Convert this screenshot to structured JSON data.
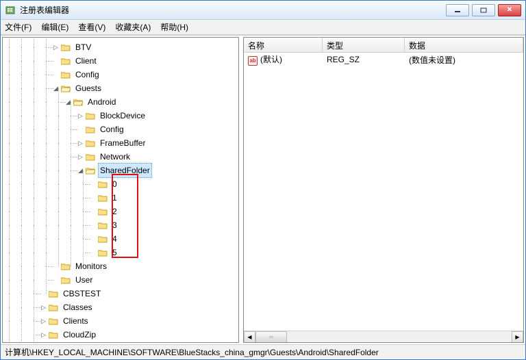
{
  "window": {
    "title": "注册表编辑器"
  },
  "menu": {
    "file": "文件(F)",
    "edit": "编辑(E)",
    "view": "查看(V)",
    "favorites": "收藏夹(A)",
    "help": "帮助(H)"
  },
  "tree": {
    "items": [
      {
        "label": "BTV",
        "depth": 4,
        "expander": "▷"
      },
      {
        "label": "Client",
        "depth": 4,
        "expander": ""
      },
      {
        "label": "Config",
        "depth": 4,
        "expander": ""
      },
      {
        "label": "Guests",
        "depth": 4,
        "expander": "◢",
        "open": true
      },
      {
        "label": "Android",
        "depth": 5,
        "expander": "◢",
        "open": true
      },
      {
        "label": "BlockDevice",
        "depth": 6,
        "expander": "▷"
      },
      {
        "label": "Config",
        "depth": 6,
        "expander": ""
      },
      {
        "label": "FrameBuffer",
        "depth": 6,
        "expander": "▷"
      },
      {
        "label": "Network",
        "depth": 6,
        "expander": "▷"
      },
      {
        "label": "SharedFolder",
        "depth": 6,
        "expander": "◢",
        "open": true,
        "selected": true
      },
      {
        "label": "0",
        "depth": 7,
        "expander": ""
      },
      {
        "label": "1",
        "depth": 7,
        "expander": ""
      },
      {
        "label": "2",
        "depth": 7,
        "expander": ""
      },
      {
        "label": "3",
        "depth": 7,
        "expander": ""
      },
      {
        "label": "4",
        "depth": 7,
        "expander": ""
      },
      {
        "label": "5",
        "depth": 7,
        "expander": ""
      },
      {
        "label": "Monitors",
        "depth": 4,
        "expander": ""
      },
      {
        "label": "User",
        "depth": 4,
        "expander": ""
      },
      {
        "label": "CBSTEST",
        "depth": 3,
        "expander": ""
      },
      {
        "label": "Classes",
        "depth": 3,
        "expander": "▷"
      },
      {
        "label": "Clients",
        "depth": 3,
        "expander": "▷"
      },
      {
        "label": "CloudZip",
        "depth": 3,
        "expander": "▷"
      }
    ]
  },
  "list": {
    "columns": {
      "name": "名称",
      "type": "类型",
      "data": "数据"
    },
    "rows": [
      {
        "name": "(默认)",
        "type": "REG_SZ",
        "data": "(数值未设置)",
        "icon": "ab"
      }
    ]
  },
  "statusbar": {
    "path": "计算机\\HKEY_LOCAL_MACHINE\\SOFTWARE\\BlueStacks_china_gmgr\\Guests\\Android\\SharedFolder"
  }
}
